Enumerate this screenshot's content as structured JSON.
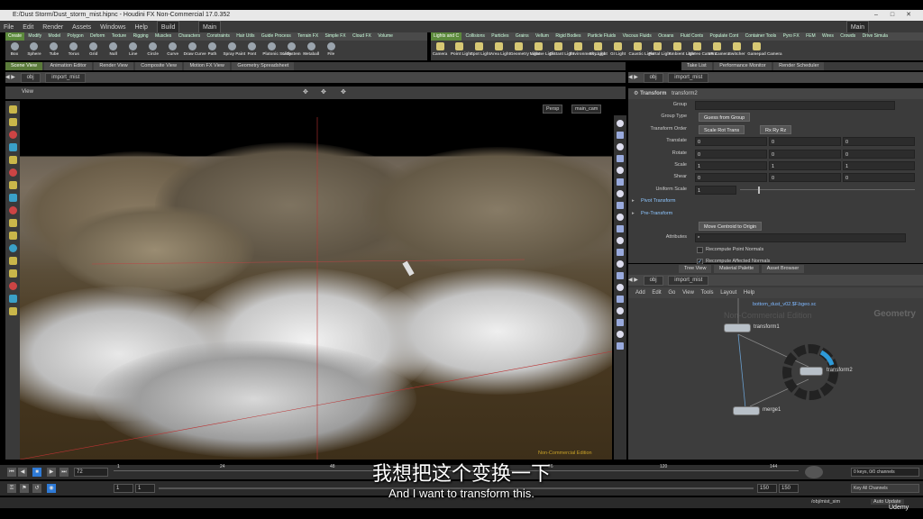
{
  "window": {
    "title": "E:/Dust Storm/Dust_storm_mist.hipnc - Houdini FX Non-Commercial 17.0.352"
  },
  "menubar": {
    "items": [
      "File",
      "Edit",
      "Render",
      "Assets",
      "Windows",
      "Help"
    ],
    "desktop": "Build",
    "desktop_right": "Main"
  },
  "shelf_left": {
    "tabs": [
      "Create",
      "Modify",
      "Model",
      "Polygon",
      "Deform",
      "Texture",
      "Rigging",
      "Muscles",
      "Characters",
      "Constraints",
      "Hair Utils",
      "Guide Process",
      "Terrain FX",
      "Simple FX",
      "Cloud FX",
      "Volume"
    ],
    "tools": [
      "Box",
      "Sphere",
      "Tube",
      "Torus",
      "Grid",
      "Null",
      "Line",
      "Circle",
      "Curve",
      "Draw Curve",
      "Path",
      "Spray Paint",
      "Font",
      "Platonic Solids",
      "L-System",
      "Metaball",
      "File"
    ]
  },
  "shelf_right": {
    "tabs": [
      "Lights and C",
      "Collisions",
      "Particles",
      "Grains",
      "Vellum",
      "Rigid Bodies",
      "Particle Fluids",
      "Viscous Fluids",
      "Oceans",
      "Fluid Conts",
      "Populate Cont",
      "Container Tools",
      "Pyro FX",
      "FEM",
      "Wires",
      "Crowds",
      "Drive Simula"
    ],
    "tools": [
      "Camera",
      "Point Light",
      "Spot Light",
      "Area Light",
      "Geometry Light",
      "Volume Light",
      "Distant Light",
      "Environment Light",
      "Sky Light",
      "GI Light",
      "Caustic Light",
      "Portal Light",
      "Ambient Light",
      "Stereo Camera",
      "VR Camera",
      "Switcher",
      "Gamepad Camera"
    ]
  },
  "pane_tabs_left": [
    "Scene View",
    "Animation Editor",
    "Render View",
    "Composite View",
    "Motion FX View",
    "Geometry Spreadsheet"
  ],
  "pane_tabs_right": [
    "Take List",
    "Performance Monitor",
    "Render Scheduler"
  ],
  "path_left": {
    "root": "obj",
    "node": "import_mist"
  },
  "viewport": {
    "label": "View",
    "camera_mode": "Persp",
    "camera": "main_cam",
    "watermark": "Non-Commercial Edition"
  },
  "params": {
    "node_type": "Transform",
    "node_name": "transform2",
    "group_label": "Group",
    "group_type_label": "Group Type",
    "group_type_value": "Guess from Group",
    "transform_order_label": "Transform Order",
    "transform_order_value": "Scale Rot Trans",
    "rot_order_value": "Rx Ry Rz",
    "translate_label": "Translate",
    "translate": [
      "0",
      "0",
      "0"
    ],
    "rotate_label": "Rotate",
    "rotate": [
      "0",
      "0",
      "0"
    ],
    "scale_label": "Scale",
    "scale": [
      "1",
      "1",
      "1"
    ],
    "shear_label": "Shear",
    "shear": [
      "0",
      "0",
      "0"
    ],
    "uniform_scale_label": "Uniform Scale",
    "uniform_scale": "1",
    "pivot_transform": "Pivot Transform",
    "pre_transform": "Pre-Transform",
    "move_centroid": "Move Centroid to Origin",
    "attributes_label": "Attributes",
    "attributes_value": "*",
    "recompute_point_normals": "Recompute Point Normals",
    "recompute_affected_normals": "Recompute Affected Normals"
  },
  "network": {
    "tabs": [
      "Tree View",
      "Material Palette",
      "Asset Browser"
    ],
    "path_root": "obj",
    "path_node": "import_mist",
    "menu": [
      "Add",
      "Edit",
      "Go",
      "View",
      "Tools",
      "Layout",
      "Help"
    ],
    "context_label": "Geometry",
    "watermark": "Non-Commercial Edition",
    "file_label": "bottom_dust_v02.$F.bgeo.sc",
    "nodes": [
      {
        "name": "transform1"
      },
      {
        "name": "transform2"
      },
      {
        "name": "merge1"
      }
    ]
  },
  "timeline": {
    "current_frame": "72",
    "ticks": [
      "1",
      "24",
      "48",
      "96",
      "120",
      "144"
    ],
    "start": "1",
    "start2": "1",
    "end": "150",
    "end2": "150",
    "keys_info": "0 keys, 0/0 channels",
    "key_all": "Key All Channels",
    "obj_path": "/obj/mist_sim",
    "auto_update": "Auto Update"
  },
  "subtitles": {
    "cn": "我想把这个变换一下",
    "en": "And I want to transform this."
  },
  "branding": "Udemy"
}
